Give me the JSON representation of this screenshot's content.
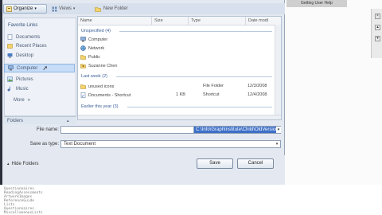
{
  "window": {
    "background_title": "Getting User Help"
  },
  "toolbar": {
    "organize": "Organize",
    "views": "Views",
    "new_folder": "New Folder"
  },
  "nav": {
    "heading": "Favorite Links",
    "items": [
      {
        "label": "Documents",
        "icon": "documents-icon"
      },
      {
        "label": "Recent Places",
        "icon": "recent-places-icon"
      },
      {
        "label": "Desktop",
        "icon": "desktop-icon"
      },
      {
        "label": "Computer",
        "icon": "computer-icon",
        "selected": true
      },
      {
        "label": "Pictures",
        "icon": "pictures-icon"
      },
      {
        "label": "Music",
        "icon": "music-icon"
      },
      {
        "label": "More",
        "icon": "more-icon"
      }
    ],
    "folders_label": "Folders"
  },
  "list": {
    "columns": [
      "Name",
      "Size",
      "Type",
      "Date modi"
    ],
    "groups": [
      {
        "label": "Unspecified (4)",
        "rows": [
          {
            "name": "Computer",
            "icon": "computer-icon",
            "size": "",
            "type": "",
            "date": ""
          },
          {
            "name": "Network",
            "icon": "network-icon",
            "size": "",
            "type": "",
            "date": ""
          },
          {
            "name": "Public",
            "icon": "folder-icon",
            "size": "",
            "type": "",
            "date": ""
          },
          {
            "name": "Suzanne Chen",
            "icon": "user-folder-icon",
            "size": "",
            "type": "",
            "date": ""
          }
        ]
      },
      {
        "label": "Last week (2)",
        "rows": [
          {
            "name": "unused icons",
            "icon": "folder-icon",
            "size": "",
            "type": "File Folder",
            "date": "12/3/2008"
          },
          {
            "name": "Documents - Shortcut",
            "icon": "shortcut-icon",
            "size": "1 KB",
            "type": "Shortcut",
            "date": "12/4/2008"
          }
        ]
      },
      {
        "label": "Earlier this year (3)",
        "rows": []
      }
    ]
  },
  "form": {
    "filename_label": "File name:",
    "filename_value": "C:\\Info\\GraphInstitute\\Child\\OldVersion343.txt",
    "savetype_label": "Save as type:",
    "savetype_value": "Text Document"
  },
  "footer": {
    "hide_folders": "Hide Folders",
    "save": "Save",
    "cancel": "Cancel"
  },
  "background_text": {
    "lines": [
      "Questionnaires",
      "ReadingAssessments",
      "ArtworkImages",
      "ReferenceGuide",
      "Lists",
      "Questionnaires",
      "MiscellaneousLists"
    ]
  },
  "colors": {
    "accent": "#3d6fc7",
    "dialog_bg": "#e4e9f1",
    "selection": "#c6dcf7"
  }
}
